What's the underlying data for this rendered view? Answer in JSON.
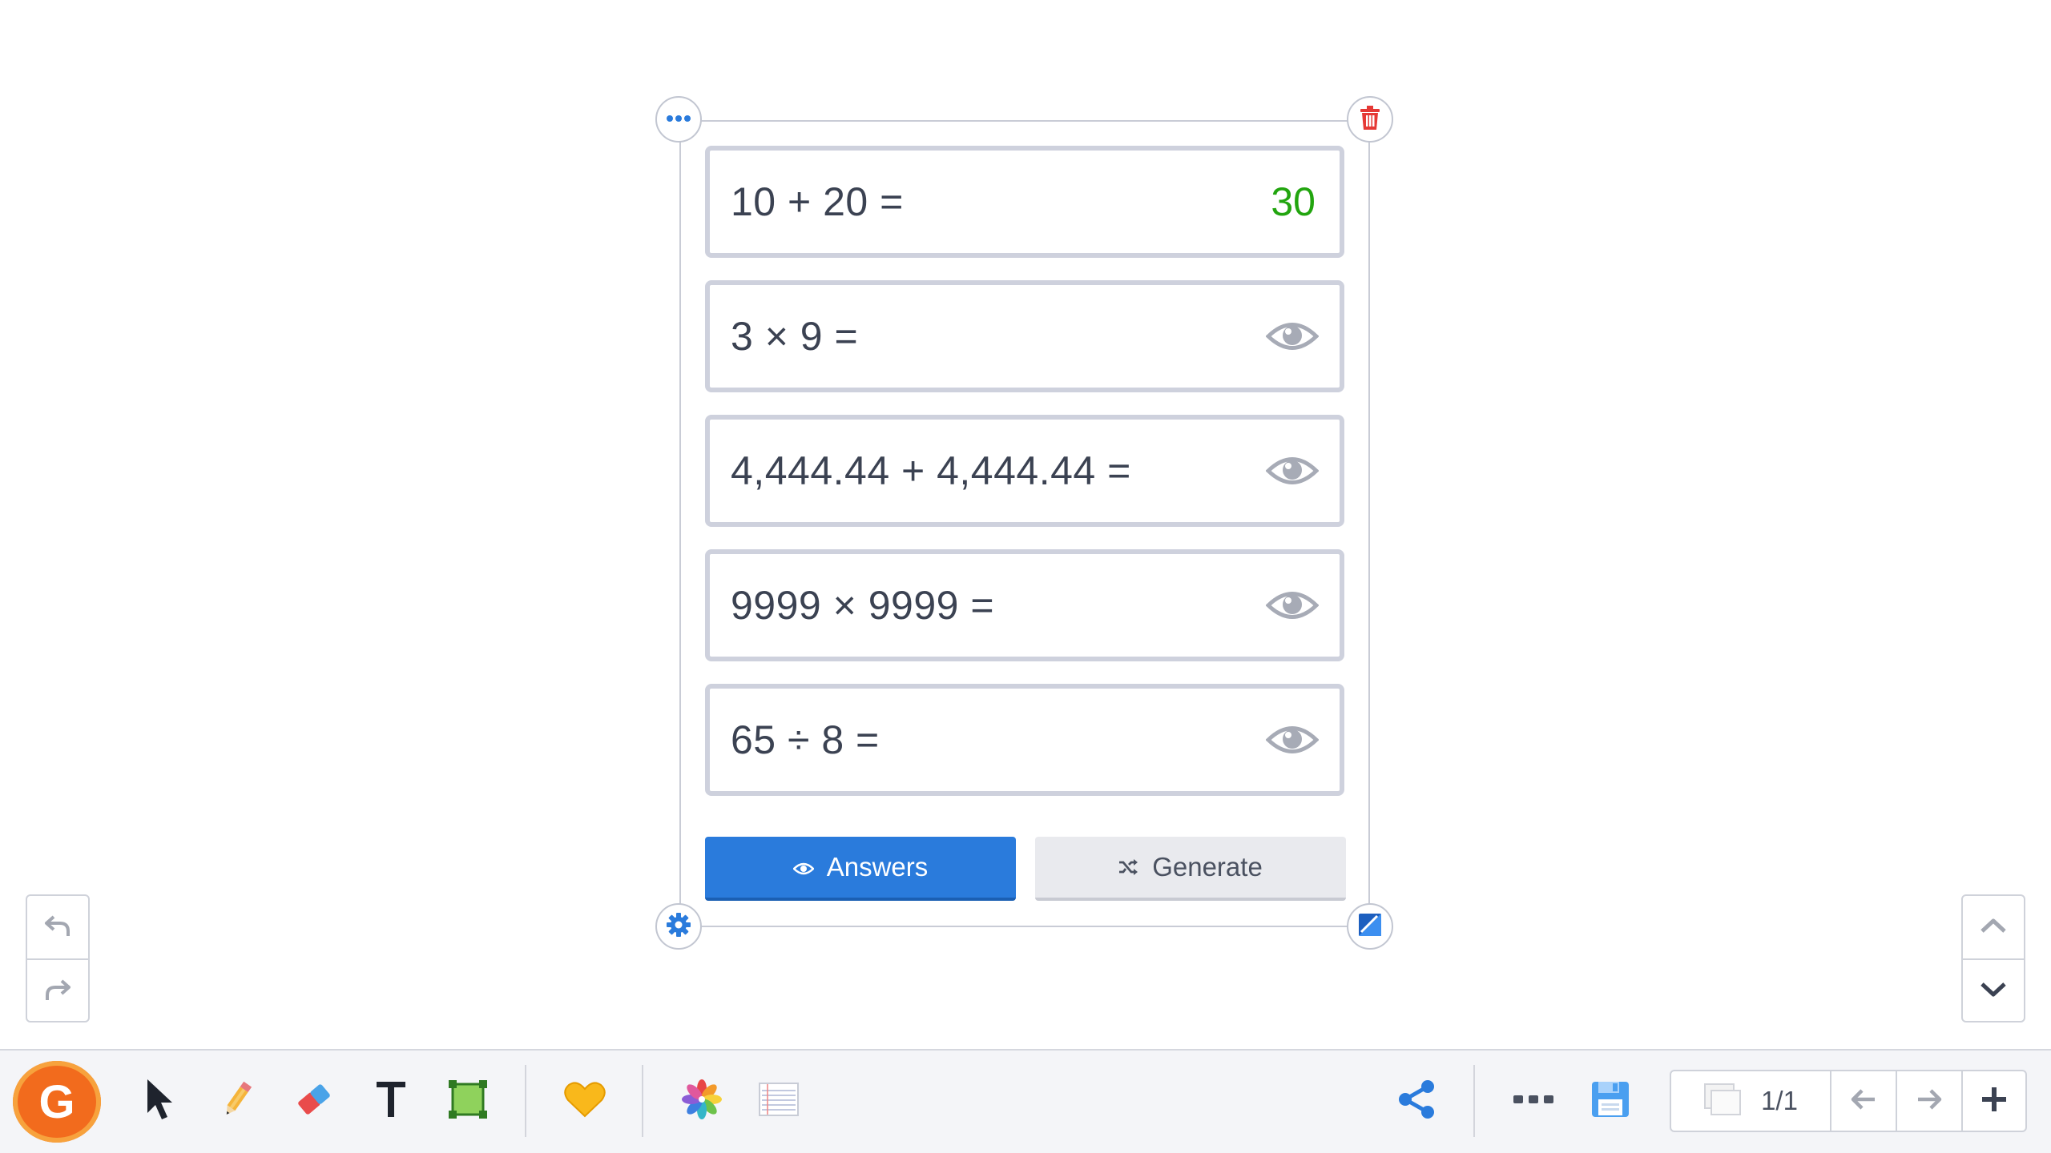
{
  "problems": [
    {
      "question": "10 + 20 =",
      "answer": "30",
      "revealed": true
    },
    {
      "question": "3 × 9 =",
      "revealed": false
    },
    {
      "question": "4,444.44 + 4,444.44 =",
      "revealed": false
    },
    {
      "question": "9999 × 9999 =",
      "revealed": false
    },
    {
      "question": "65 ÷ 8 =",
      "revealed": false
    }
  ],
  "buttons": {
    "answers_label": "Answers",
    "generate_label": "Generate"
  },
  "page_nav": {
    "page_indicator": "1/1"
  },
  "logo": {
    "letter": "G"
  },
  "colors": {
    "accent": "#2a7bdc",
    "answer": "#22a50f",
    "danger": "#e53935",
    "card_border": "#ced1dd",
    "logo": "#f26b1d"
  },
  "icons": {
    "frame_menu": "ellipsis-icon",
    "frame_delete": "trash-icon",
    "frame_settings": "gear-icon",
    "frame_resize": "resize-icon",
    "reveal": "eye-icon",
    "undo": "undo-icon",
    "redo": "redo-icon",
    "page_up": "chevron-up-icon",
    "page_down": "chevron-down-icon",
    "tools": [
      "cursor-icon",
      "pencil-icon",
      "eraser-icon",
      "text-icon",
      "shape-icon",
      "heart-icon",
      "pinwheel-icon",
      "notepad-icon",
      "share-icon",
      "more-icon",
      "save-icon",
      "pages-icon",
      "arrow-left-icon",
      "arrow-right-icon",
      "plus-icon"
    ]
  }
}
